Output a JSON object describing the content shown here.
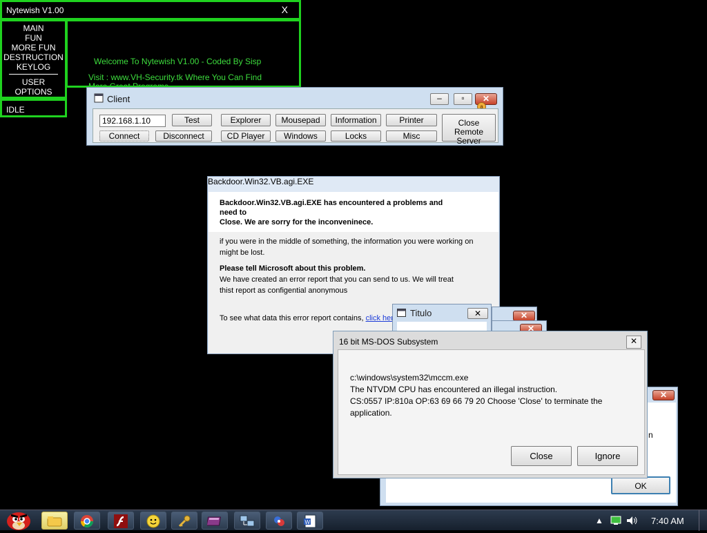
{
  "nytewish": {
    "title": "Nytewish V1.00",
    "close": "X",
    "menu": [
      "MAIN",
      "FUN",
      "MORE FUN",
      "DESTRUCTION",
      "KEYLOG",
      "USER",
      "OPTIONS"
    ],
    "welcome": "Welcome To Nytewish V1.00 - Coded By Sisp",
    "visit": "Visit : www.VH-Security.tk Where You Can Find More Great Programs",
    "status": "IDLE",
    "accent": "#1fd21f"
  },
  "client": {
    "title": "Client",
    "ip_value": "192.168.1.10",
    "buttons": {
      "test": "Test",
      "connect": "Connect",
      "disconnect": "Disconnect",
      "explorer": "Explorer",
      "cd_player": "CD Player",
      "mousepad": "Mousepad",
      "windows": "Windows",
      "information": "Information",
      "locks": "Locks",
      "printer": "Printer",
      "misc": "Misc",
      "close_remote": "Close Remote Server"
    }
  },
  "error_dialog": {
    "title": "Backdoor.Win32.VB.agi.EXE",
    "line1": "Backdoor.Win32.VB.agi.EXE has encountered a problems and",
    "line2": "need to",
    "line3": "Close. We are sorry for the inconveninece.",
    "p1a": "if you were in the middle of something, the information you were working on",
    "p1b": "might be lost.",
    "p2_bold": "Please tell Microsoft about this problem.",
    "p2a": "We have created an error report that you can send to us. We will treat",
    "p2b": "thist report as configential anonymous",
    "p3": "To see  what data this error report contains,",
    "link": "click here"
  },
  "titulo": {
    "title": "Titulo"
  },
  "dos_dialog": {
    "title": "16 bit MS-DOS Subsystem",
    "path": "c:\\windows\\system32\\mccm.exe",
    "msg1": "The NTVDM CPU has encountered an illegal instruction.",
    "msg2": "CS:0557 IP:810a OP:63 69 66 79 20 Choose 'Close' to terminate the application.",
    "close_button": "Close",
    "ignore_button": "Ignore"
  },
  "back_window": {
    "ok_button": "OK",
    "partial_text": "n"
  },
  "taskbar": {
    "time": "7:40 AM",
    "icons": [
      "angry-birds-icon",
      "explorer-icon",
      "chrome-icon",
      "flash-icon",
      "smiley-icon",
      "key-icon",
      "book-icon",
      "network-icon",
      "remote-icon",
      "word-icon"
    ]
  }
}
